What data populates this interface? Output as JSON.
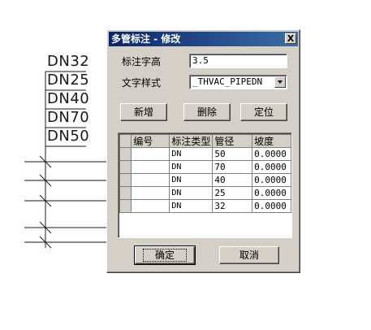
{
  "cad": {
    "labels": [
      "DN32",
      "DN25",
      "DN40",
      "DN70",
      "DN50"
    ]
  },
  "dialog": {
    "title": "多管标注 - 修改",
    "close_glyph": "X",
    "font_height_label": "标注字高",
    "font_height_value": "3.5",
    "text_style_label": "文字样式",
    "text_style_value": "_THVAC_PIPEDN",
    "buttons": {
      "add": "新增",
      "delete": "删除",
      "locate": "定位",
      "ok": "确定",
      "cancel": "取消"
    },
    "grid": {
      "headers": [
        "编号",
        "标注类型",
        "管径",
        "坡度"
      ],
      "rows": [
        {
          "id": "",
          "type": "DN",
          "diameter": "50",
          "slope": "0.0000"
        },
        {
          "id": "",
          "type": "DN",
          "diameter": "70",
          "slope": "0.0000"
        },
        {
          "id": "",
          "type": "DN",
          "diameter": "40",
          "slope": "0.0000"
        },
        {
          "id": "",
          "type": "DN",
          "diameter": "25",
          "slope": "0.0000"
        },
        {
          "id": "",
          "type": "DN",
          "diameter": "32",
          "slope": "0.0000"
        }
      ]
    }
  }
}
